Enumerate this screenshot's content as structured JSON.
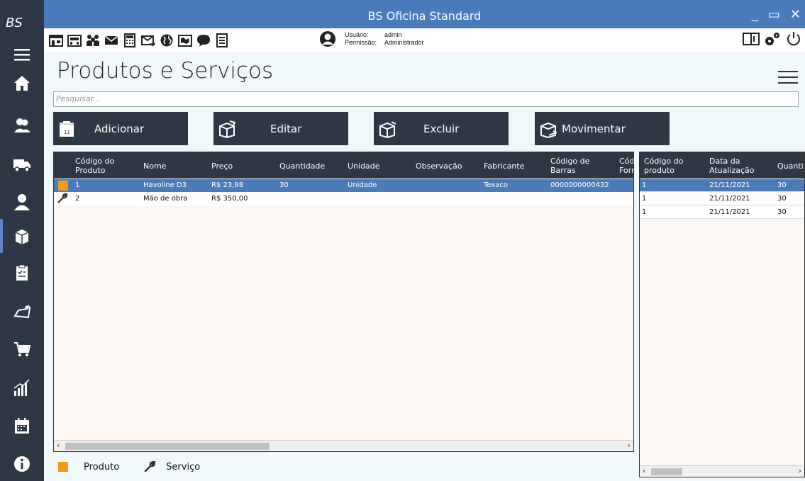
{
  "app": {
    "logo": "BS",
    "title": "BS Oficina Standard",
    "window_controls": [
      "_",
      "▭",
      "✕"
    ]
  },
  "user": {
    "user_label": "Usuário:",
    "user_value": "admin",
    "perm_label": "Permissão:",
    "perm_value": "Administrador"
  },
  "page": {
    "title": "Produtos e Serviços",
    "search_placeholder": "Pesquisar..."
  },
  "actions": {
    "add": "Adicionar",
    "edit": "Editar",
    "delete": "Excluir",
    "move": "Movimentar"
  },
  "main_grid": {
    "headers": [
      "Código do Produto",
      "Nome",
      "Preço",
      "Quantidade",
      "Unidade",
      "Observação",
      "Fabricante",
      "Código de Barras",
      "Cód Forn"
    ],
    "rows": [
      {
        "type": "produto",
        "codigo": "1",
        "nome": "Havoline D3",
        "preco": "R$ 23,98",
        "quantidade": "30",
        "unidade": "Unidade",
        "observacao": "",
        "fabricante": "Texaco",
        "barras": "0000000000432"
      },
      {
        "type": "servico",
        "codigo": "2",
        "nome": "Mão de obra",
        "preco": "R$ 350,00",
        "quantidade": "",
        "unidade": "",
        "observacao": "",
        "fabricante": "",
        "barras": ""
      }
    ]
  },
  "side_grid": {
    "headers": [
      "Código do produto",
      "Data da Atualização",
      "Quanti"
    ],
    "rows": [
      {
        "codigo": "1",
        "data": "21/11/2021",
        "qtd": "30"
      },
      {
        "codigo": "1",
        "data": "21/11/2021",
        "qtd": "30"
      },
      {
        "codigo": "1",
        "data": "21/11/2021",
        "qtd": "30"
      }
    ]
  },
  "legend": {
    "produto": "Produto",
    "servico": "Serviço"
  },
  "colors": {
    "sidebar": "#2d3745",
    "titlebar": "#4a7cbc",
    "selected_row": "#4a7cbc",
    "produto": "#f39c12"
  }
}
